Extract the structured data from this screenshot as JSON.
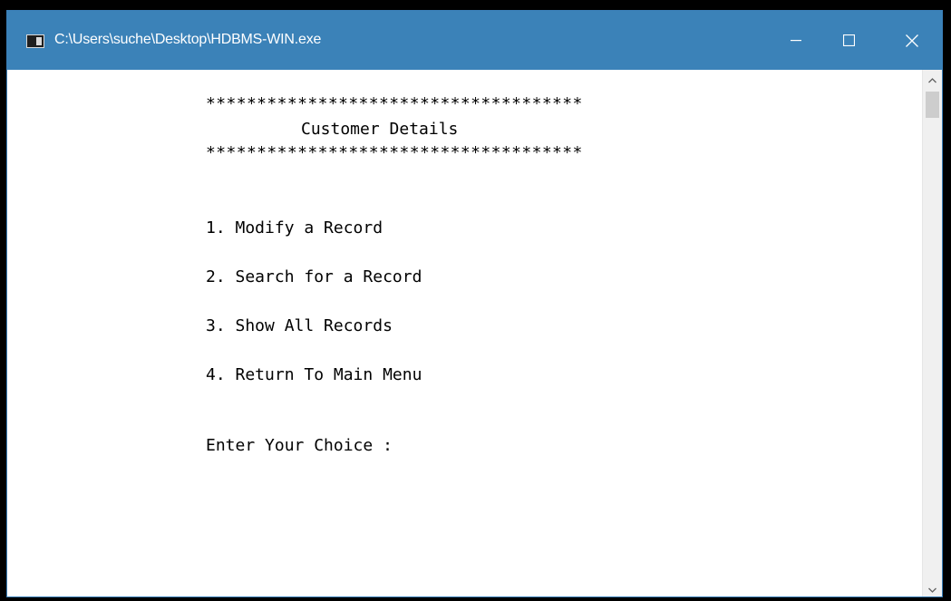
{
  "window": {
    "title": "C:\\Users\\suche\\Desktop\\HDBMS-WIN.exe",
    "icon": "console-app-icon",
    "controls": {
      "minimize": "minimize-icon",
      "maximize": "maximize-icon",
      "close": "close-icon"
    },
    "titlebar_color": "#3b82b8"
  },
  "console": {
    "border_top": "*************************************",
    "heading": "Customer Details",
    "border_bottom": "*************************************",
    "menu": [
      "1. Modify a Record",
      "2. Search for a Record",
      "3. Show All Records",
      "4. Return To Main Menu"
    ],
    "prompt": "Enter Your Choice :"
  },
  "scrollbar": {
    "up_icon": "chevron-up-icon",
    "down_icon": "chevron-down-icon"
  }
}
